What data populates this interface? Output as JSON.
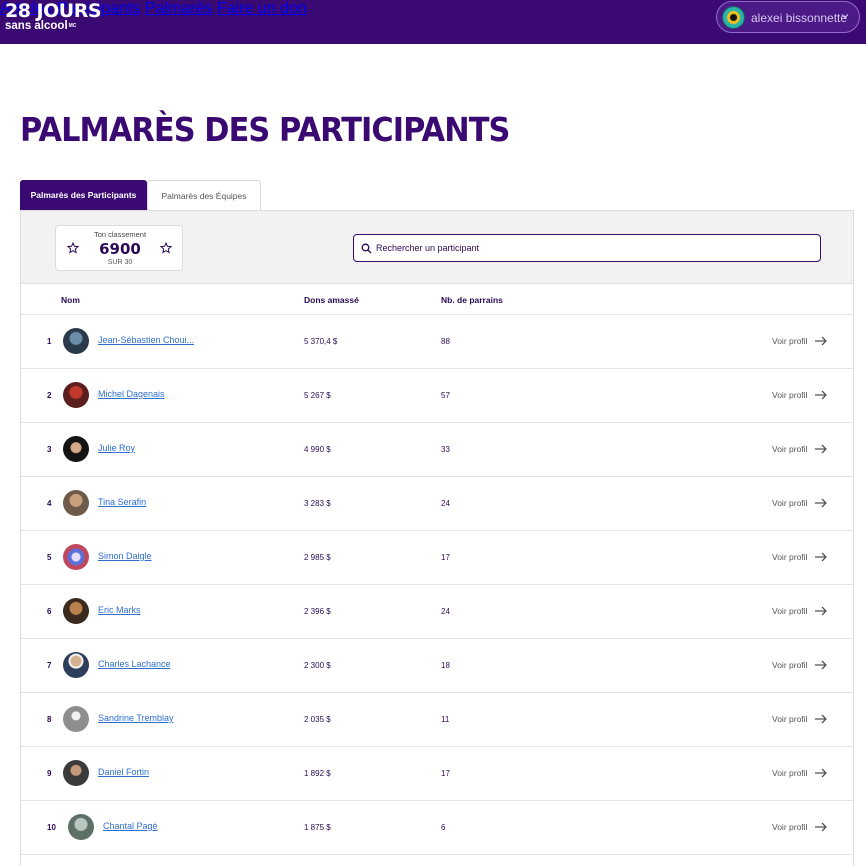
{
  "header": {
    "logo_line1": "28 JOURS",
    "logo_line2": "sans alcool",
    "logo_mark": "MC",
    "nav": [
      "Articles",
      "Participants",
      "Palmarès",
      "Faire un don"
    ],
    "user_name": "alexei bissonnette",
    "colors": {
      "brand": "#3a0a72",
      "link": "#2f6fd1"
    }
  },
  "page_title": "PALMARÈS DES PARTICIPANTS",
  "tabs": [
    {
      "label": "Palmarès des Participants",
      "active": true
    },
    {
      "label": "Palmarès des Équipes",
      "active": false
    }
  ],
  "ranking": {
    "label": "Ton classement",
    "value": "6900",
    "sub": "SUR 30"
  },
  "search": {
    "placeholder": "Rechercher un participant"
  },
  "columns": {
    "name": "Nom",
    "donations": "Dons amassé",
    "sponsors": "Nb. de parrains"
  },
  "rows": [
    {
      "rank": "1",
      "name": "Jean-Sébastien Choui...",
      "donations": "5 370,4 $",
      "sponsors": "88",
      "action": "Voir profil"
    },
    {
      "rank": "2",
      "name": "Michel Dagenais",
      "donations": "5 267 $",
      "sponsors": "57",
      "action": "Voir profil"
    },
    {
      "rank": "3",
      "name": "Julie Roy",
      "donations": "4 990 $",
      "sponsors": "33",
      "action": "Voir profil"
    },
    {
      "rank": "4",
      "name": "Tina Serafin",
      "donations": "3 283 $",
      "sponsors": "24",
      "action": "Voir profil"
    },
    {
      "rank": "5",
      "name": "Simon Daigle",
      "donations": "2 985 $",
      "sponsors": "17",
      "action": "Voir profil"
    },
    {
      "rank": "6",
      "name": "Eric Marks",
      "donations": "2 396 $",
      "sponsors": "24",
      "action": "Voir profil"
    },
    {
      "rank": "7",
      "name": "Charles Lachance",
      "donations": "2 300 $",
      "sponsors": "18",
      "action": "Voir profil"
    },
    {
      "rank": "8",
      "name": "Sandrine Tremblay",
      "donations": "2 035 $",
      "sponsors": "11",
      "action": "Voir profil"
    },
    {
      "rank": "9",
      "name": "Daniel Fortin",
      "donations": "1 892 $",
      "sponsors": "17",
      "action": "Voir profil"
    },
    {
      "rank": "10",
      "name": "Chantal Pagé",
      "donations": "1 875 $",
      "sponsors": "6",
      "action": "Voir profil"
    }
  ]
}
